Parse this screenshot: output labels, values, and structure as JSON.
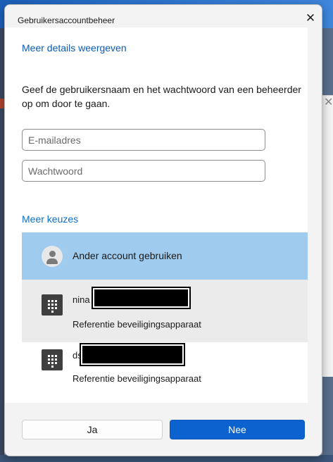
{
  "window": {
    "title": "Gebruikersaccountbeheer"
  },
  "dialog": {
    "details_link": "Meer details weergeven",
    "instruction": "Geef de gebruikersnaam en het wachtwoord van een beheerder op om door te gaan.",
    "email_placeholder": "E-mailadres",
    "password_placeholder": "Wachtwoord",
    "more_choices": "Meer keuzes",
    "options": [
      {
        "label": "Ander account gebruiken",
        "icon": "person-icon",
        "state": "selected"
      },
      {
        "name": "nina",
        "subtitle": "Referentie beveiligingsapparaat",
        "icon": "keypad-icon",
        "state": "hover"
      },
      {
        "name": "ds",
        "subtitle": "Referentie beveiligingsapparaat",
        "icon": "keypad-icon",
        "state": "normal"
      }
    ],
    "buttons": {
      "yes": "Ja",
      "no": "Nee"
    }
  },
  "colors": {
    "accent": "#0c63cf",
    "link": "#0a5cb5",
    "selected_option": "#9ecbee",
    "hover_option": "#ebebeb"
  }
}
